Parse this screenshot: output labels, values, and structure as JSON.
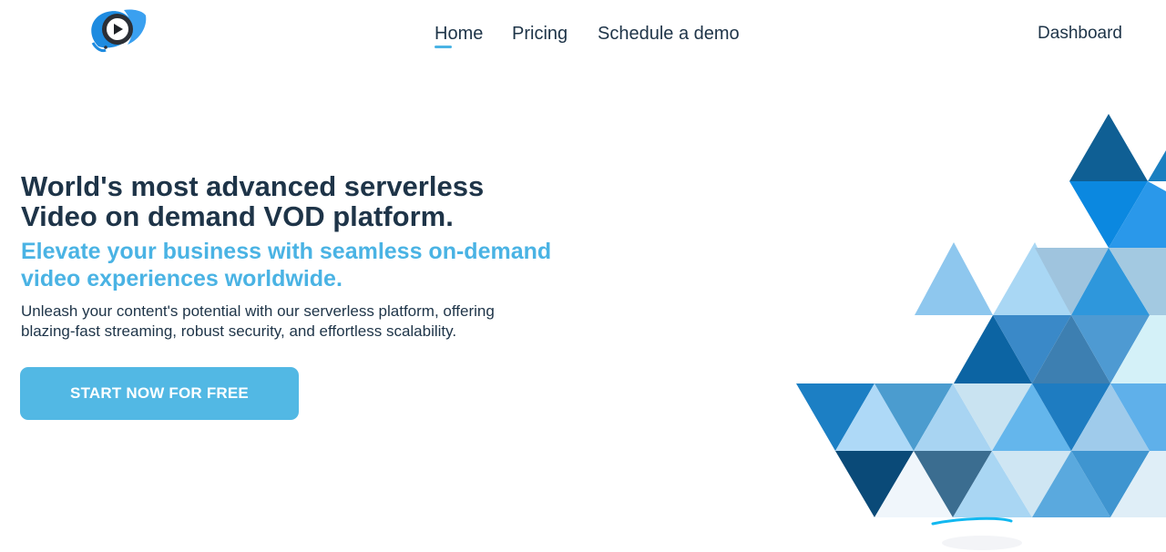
{
  "header": {
    "logo_icon": "play-logo-icon",
    "nav": [
      {
        "label": "Home",
        "active": true
      },
      {
        "label": "Pricing",
        "active": false
      },
      {
        "label": "Schedule a demo",
        "active": false
      }
    ],
    "dashboard_label": "Dashboard"
  },
  "hero": {
    "title_line1": "World's most advanced serverless",
    "title_line2": "Video on demand VOD platform.",
    "subtitle_line1": "Elevate your business with seamless on-demand",
    "subtitle_line2": "video experiences worldwide.",
    "desc_line1": "Unleash your content's potential with our serverless platform, offering",
    "desc_line2": "blazing-fast streaming, robust security, and effortless scalability.",
    "cta_label": "START NOW FOR FREE"
  },
  "colors": {
    "text": "#1e3448",
    "accent": "#4ab3e4",
    "cta_bg": "#52b8e4"
  }
}
